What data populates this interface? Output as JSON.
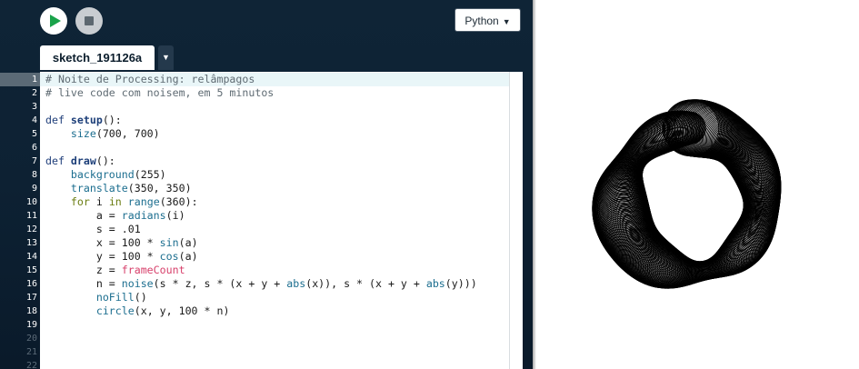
{
  "toolbar": {
    "run_label": "Run",
    "stop_label": "Stop",
    "mode": "Python",
    "mode_caret": "▼"
  },
  "tab": {
    "name": "sketch_191126a",
    "menu_caret": "▼"
  },
  "line_numbers": [
    "1",
    "2",
    "3",
    "4",
    "5",
    "6",
    "7",
    "8",
    "9",
    "10",
    "11",
    "12",
    "13",
    "14",
    "15",
    "16",
    "17",
    "18",
    "19",
    "20",
    "21",
    "22"
  ],
  "active_line": 1,
  "code": {
    "l1": "# Noite de Processing: relâmpagos",
    "l2": "# live code com noisem, em 5 minutos",
    "l4_def": "def ",
    "l4_name": "setup",
    "l4_rest": "():",
    "l5_fn": "size",
    "l5_rest": "(700, 700)",
    "l7_def": "def ",
    "l7_name": "draw",
    "l7_rest": "():",
    "l8_fn": "background",
    "l8_rest": "(255)",
    "l9_fn": "translate",
    "l9_rest": "(350, 350)",
    "l10_for": "for",
    "l10_mid": " i ",
    "l10_in": "in",
    "l10_sp": " ",
    "l10_range": "range",
    "l10_rest": "(360):",
    "l11_a": "a = ",
    "l11_fn": "radians",
    "l11_rest": "(i)",
    "l12": "s = .01",
    "l13_a": "x = 100 * ",
    "l13_fn": "sin",
    "l13_rest": "(a)",
    "l14_a": "y = 100 * ",
    "l14_fn": "cos",
    "l14_rest": "(a)",
    "l15_a": "z = ",
    "l15_fc": "frameCount",
    "l16_a": "n = ",
    "l16_noise": "noise",
    "l16_b": "(s * z, s * (x + y + ",
    "l16_abs1": "abs",
    "l16_c": "(x)), s * (x + y + ",
    "l16_abs2": "abs",
    "l16_d": "(y)))",
    "l17_fn": "noFill",
    "l17_rest": "()",
    "l18_fn": "circle",
    "l18_rest": "(x, y, 100 * n)"
  },
  "sketch_output": {
    "circle_count": 360,
    "orbit_radius": 100,
    "base_diameter": 100,
    "noise_scale": 0.01,
    "stroke_color": "#000000",
    "background": "#ffffff"
  },
  "colors": {
    "run_green": "#1aa34a",
    "editor_bg": "#0f2436",
    "comment": "#5f6b73",
    "keyword": "#1f3e7a",
    "builtin": "#1c6e8f",
    "for_keyword": "#6b7d12",
    "frameCount": "#d7406b"
  }
}
